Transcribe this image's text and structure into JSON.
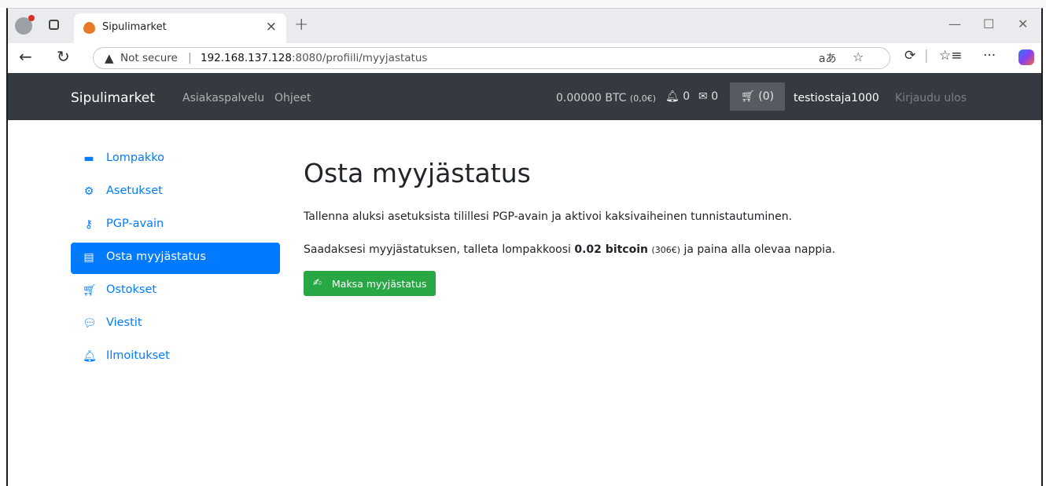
{
  "browser": {
    "tab_title": "Sipulimarket",
    "tab_close": "×",
    "new_tab": "+",
    "security_label": "Not secure",
    "separator": "|",
    "url_host": "192.168.137.128",
    "url_rest": ":8080/profiili/myyjastatus",
    "minimize": "—",
    "maximize": "☐",
    "close": "✕"
  },
  "site_nav": {
    "brand": "Sipulimarket",
    "links": [
      "Asiakaspalvelu",
      "Ohjeet"
    ],
    "balance_btc": "0.00000 BTC",
    "balance_eur": "(0,0€)",
    "notifications_count": "0",
    "messages_count": "0",
    "cart_count": "(0)",
    "username": "testiostaja1000",
    "logout": "Kirjaudu ulos"
  },
  "sidebar": {
    "items": [
      {
        "label": "Lompakko",
        "icon": "wallet-icon"
      },
      {
        "label": "Asetukset",
        "icon": "gear-icon"
      },
      {
        "label": "PGP-avain",
        "icon": "key-icon"
      },
      {
        "label": "Osta myyjästatus",
        "icon": "id-card-icon",
        "active": true
      },
      {
        "label": "Ostokset",
        "icon": "cart-icon"
      },
      {
        "label": "Viestit",
        "icon": "chat-icon"
      },
      {
        "label": "Ilmoitukset",
        "icon": "bell-icon"
      }
    ]
  },
  "main": {
    "title": "Osta myyjästatus",
    "paragraph1": "Tallenna aluksi asetuksista tilillesi PGP-avain ja aktivoi kaksivaiheinen tunnistautuminen.",
    "paragraph2_before": "Saadaksesi myyjästatuksen, talleta lompakkoosi ",
    "paragraph2_amount": "0.02 bitcoin",
    "paragraph2_eur": "(306€)",
    "paragraph2_after": " ja paina alla olevaa nappia.",
    "pay_button": "Maksa myyjästatus"
  },
  "colors": {
    "navbar_bg": "#343a40",
    "primary": "#007bff",
    "success": "#28a745"
  }
}
